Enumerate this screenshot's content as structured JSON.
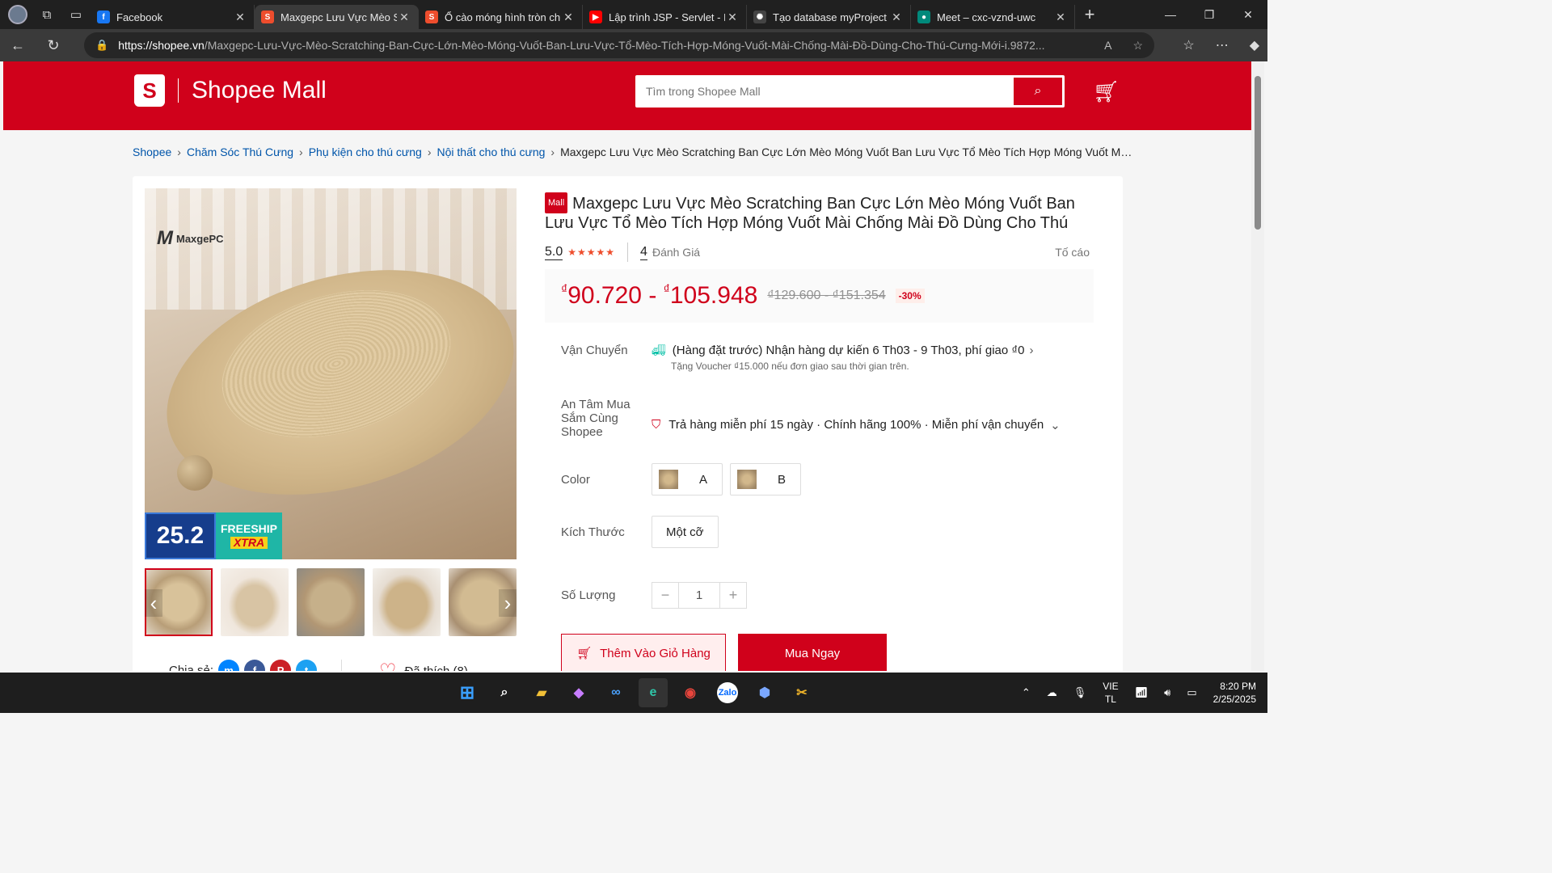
{
  "browser": {
    "tabs": [
      {
        "title": "Facebook",
        "favicon": "facebook-icon",
        "color": "#1877f2",
        "glyph": "f"
      },
      {
        "title": "Maxgepc Lưu Vực Mèo Sc",
        "favicon": "shopee-icon",
        "color": "#ee4d2d",
        "glyph": "S",
        "active": true
      },
      {
        "title": "Ổ cào móng hình tròn chu",
        "favicon": "shopee-icon",
        "color": "#ee4d2d",
        "glyph": "S"
      },
      {
        "title": "Lập trình JSP - Servlet - Lậ",
        "favicon": "youtube-icon",
        "color": "#ff0000",
        "glyph": "▶"
      },
      {
        "title": "Tạo database myProject",
        "favicon": "chatgpt-icon",
        "color": "#444444",
        "glyph": "✺"
      },
      {
        "title": "Meet – cxc-vznd-uwc",
        "favicon": "meet-icon",
        "color": "#00897b",
        "glyph": "●"
      }
    ],
    "url_domain": "https://shopee.vn",
    "url_path": "/Maxgepc-Lưu-Vực-Mèo-Scratching-Ban-Cực-Lớn-Mèo-Móng-Vuốt-Ban-Lưu-Vực-Tổ-Mèo-Tích-Hợp-Móng-Vuốt-Mài-Chống-Mài-Đồ-Dùng-Cho-Thú-Cưng-Mới-i.9872..."
  },
  "header": {
    "logo_glyph": "S",
    "logo_text": "Shopee Mall",
    "search_placeholder": "Tìm trong Shopee Mall"
  },
  "breadcrumb": {
    "items": [
      "Shopee",
      "Chăm Sóc Thú Cưng",
      "Phụ kiện cho thú cưng",
      "Nội thất cho thú cưng"
    ],
    "current": "Maxgepc Lưu Vực Mèo Scratching Ban Cực Lớn Mèo Móng Vuốt Ban Lưu Vực Tổ Mèo Tích Hợp Móng Vuốt Mài Chống Mài Đồ Dùng Cho Thú Cưng Mới"
  },
  "gallery": {
    "brand_watermark": "MaxgePC",
    "promo_date": "25.2",
    "promo_freeship": "FREESHIP",
    "promo_xtra": "XTRA"
  },
  "product": {
    "mall_badge": "Mall",
    "title": "Maxgepc Lưu Vực Mèo Scratching Ban Cực Lớn Mèo Móng Vuốt Ban Lưu Vực Tổ Mèo Tích Hợp Móng Vuốt Mài Chống Mài Đồ Dùng Cho Thú Cưng Mới",
    "rating": "5.0",
    "stars": "★★★★★",
    "review_count": "4",
    "review_label": "Đánh Giá",
    "report": "Tố cáo",
    "currency": "₫",
    "price_low": "90.720",
    "price_sep": " - ",
    "price_high": "105.948",
    "old_price": "₫129.600 - ₫151.354",
    "discount": "-30%"
  },
  "shipping": {
    "label": "Vận Chuyển",
    "text": "(Hàng đặt trước) Nhận hàng dự kiến 6 Th03 - 9 Th03, phí giao ₫0",
    "voucher": "Tặng Voucher ₫15.000 nếu đơn giao sau thời gian trên."
  },
  "assurance": {
    "label": "An Tâm Mua Sắm Cùng Shopee",
    "text": "Trả hàng miễn phí 15 ngày · Chính hãng 100% · Miễn phí vận chuyển"
  },
  "color": {
    "label": "Color",
    "options": [
      "A",
      "B"
    ]
  },
  "size": {
    "label": "Kích Thước",
    "option": "Một cỡ"
  },
  "quantity": {
    "label": "Số Lượng",
    "minus": "−",
    "value": "1",
    "plus": "+"
  },
  "actions": {
    "add_to_cart": "Thêm Vào Giỏ Hàng",
    "buy_now": "Mua Ngay"
  },
  "social": {
    "share_label": "Chia sẻ:",
    "liked_label": "Đã thích (8)"
  },
  "taskbar": {
    "lang_top": "VIE",
    "lang_bottom": "TL",
    "time": "8:20 PM",
    "date": "2/25/2025"
  },
  "colors": {
    "brand": "#d0011b",
    "price": "#d0011b",
    "ship_icon": "#00bfa5"
  }
}
